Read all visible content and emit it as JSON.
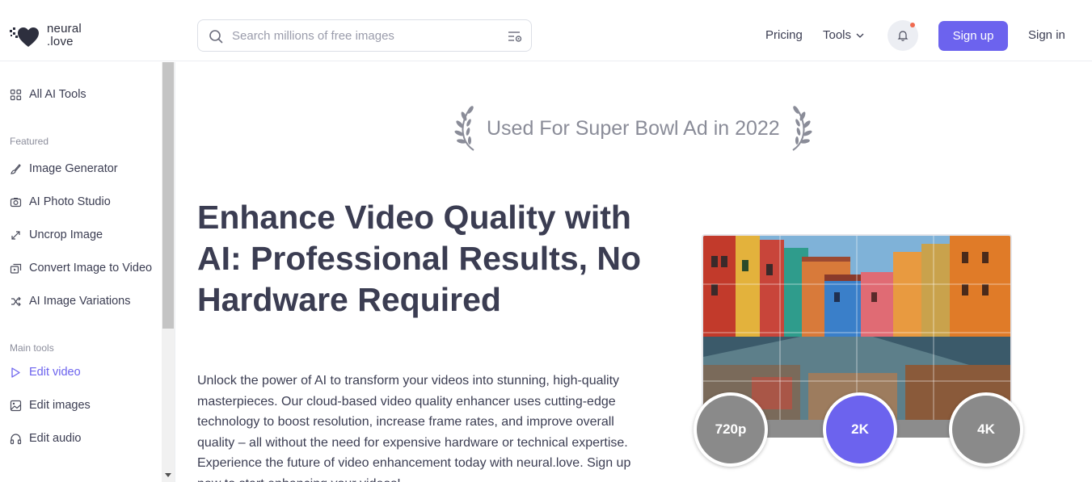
{
  "brand": {
    "line1": "neural",
    "line2": ".love"
  },
  "search": {
    "placeholder": "Search millions of free images",
    "value": ""
  },
  "nav": {
    "pricing": "Pricing",
    "tools": "Tools",
    "signup": "Sign up",
    "signin": "Sign in"
  },
  "sidebar": {
    "all_tools": "All AI Tools",
    "featured_label": "Featured",
    "featured": [
      {
        "label": "Image Generator",
        "icon": "brush-icon"
      },
      {
        "label": "AI Photo Studio",
        "icon": "camera-icon"
      },
      {
        "label": "Uncrop Image",
        "icon": "expand-icon"
      },
      {
        "label": "Convert Image to Video",
        "icon": "image-to-video-icon"
      },
      {
        "label": "AI Image Variations",
        "icon": "shuffle-icon"
      }
    ],
    "main_label": "Main tools",
    "main": [
      {
        "label": "Edit video",
        "icon": "play-icon",
        "active": true
      },
      {
        "label": "Edit images",
        "icon": "image-icon"
      },
      {
        "label": "Edit audio",
        "icon": "headphones-icon"
      }
    ]
  },
  "award": {
    "text": "Used For Super Bowl Ad in 2022"
  },
  "hero": {
    "title": "Enhance Video Quality with AI: Professional Results, No Hardware Required",
    "description": "Unlock the power of AI to transform your videos into stunning, high-quality masterpieces. Our cloud-based video quality enhancer uses cutting-edge technology to boost resolution, increase frame rates, and improve overall quality – all without the need for expensive hardware or technical expertise. Experience the future of video enhancement today with neural.love. Sign up now to start enhancing your videos!"
  },
  "resolutions": {
    "low": "720p",
    "mid": "2K",
    "high": "4K",
    "selected": "2K"
  },
  "colors": {
    "accent": "#6c63ee",
    "text": "#3b3d52",
    "muted": "#8a8c98",
    "notification": "#f06a4f"
  }
}
